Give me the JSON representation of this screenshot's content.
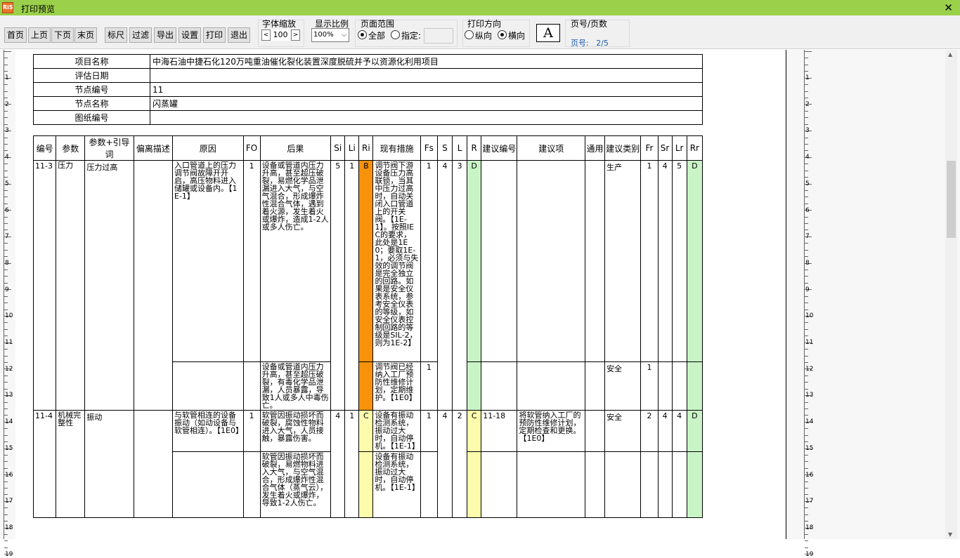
{
  "window": {
    "title": "打印预览",
    "close": "✕",
    "icon_text": "RiS"
  },
  "toolbar": {
    "buttons": [
      "首页",
      "上页",
      "下页",
      "末页",
      "标尺",
      "过滤",
      "导出",
      "设置",
      "打印",
      "退出"
    ],
    "font_scale": {
      "label": "字体缩放",
      "minus": "<",
      "value": "100",
      "plus": ">"
    },
    "display_ratio": {
      "label": "显示比例",
      "value": "100%"
    },
    "page_range": {
      "label": "页面范围",
      "all": "全部",
      "specify": "指定:",
      "selected": "all"
    },
    "orientation": {
      "label": "打印方向",
      "portrait": "纵向",
      "landscape": "横向",
      "selected": "landscape"
    },
    "font_icon": "A",
    "page_count": {
      "label": "页号/页数",
      "page_label": "页号:",
      "value": "2/5"
    }
  },
  "ruler": {
    "left": [
      "1",
      "2",
      "3",
      "4",
      "5",
      "6",
      "7",
      "8",
      "9",
      "10",
      "11",
      "12",
      "13",
      "14",
      "15",
      "16",
      "17",
      "18",
      "19"
    ],
    "right": [
      "1",
      "2",
      "3",
      "4",
      "5",
      "6",
      "7",
      "8",
      "9",
      "10",
      "11",
      "12",
      "13",
      "14",
      "15",
      "16",
      "17",
      "18",
      "19"
    ]
  },
  "info": [
    {
      "k": "项目名称",
      "v": "中海石油中捷石化120万吨重油催化裂化装置深度脱硫并予以资源化利用项目"
    },
    {
      "k": "评估日期",
      "v": ""
    },
    {
      "k": "节点编号",
      "v": "11"
    },
    {
      "k": "节点名称",
      "v": "闪蒸罐"
    },
    {
      "k": "图纸编号",
      "v": ""
    }
  ],
  "table": {
    "headers": [
      "编号",
      "参数",
      "参数+引导词",
      "偏离描述",
      "原因",
      "FO",
      "后果",
      "Si",
      "Li",
      "Ri",
      "现有措施",
      "Fs",
      "S",
      "L",
      "R",
      "建议编号",
      "建议项",
      "通用",
      "建议类别",
      "Fr",
      "Sr",
      "Lr",
      "Rr"
    ],
    "rows": [
      {
        "id": "11-3",
        "param": "压力",
        "guide": "压力过高",
        "dev": "",
        "cause": "入口管道上的压力调节阀故障开开启，高压物料进入储罐或设备内。【1E-1】",
        "fo": "1",
        "cons1": "设备或管道内压力升高，甚至超压破裂，易燃化学品泄漏进入大气，与空气混合，形成爆炸性混合气体，遇到着火源，发生着火或爆炸，造成1-2人或多人伤亡。",
        "si": "5",
        "li": "1",
        "ri": "B",
        "measure1": "调节阀下游设备压力高联锁，当其中压力过高时，自动关闭入口管道上的开关阀。【1E-1】。按照IEC的要求，此处是1E0；要取1E-1，必须与失效的调节阀是完全独立的回路。如果是安全仪表系统，参考安全仪表的等级，如安全仪表控制回路的等级是SIL-2，则为1E-2】",
        "fs": "1",
        "s": "4",
        "l": "3",
        "r": "D",
        "sug_no": "",
        "sug": "",
        "gen": "",
        "cat1": "生产",
        "fr1": "1",
        "sr": "4",
        "lr": "5",
        "rr": "D",
        "cons2": "设备或管道内压力升高，甚至超压破裂，有毒化学品泄漏，人员暴露，导致1人或多人中毒伤亡。",
        "measure2": "调节阀已经纳入工厂预防性维修计划，定期维护。【1E0】",
        "fs2": "1",
        "cat2": "安全",
        "fr2": "1"
      },
      {
        "id": "11-4",
        "param": "机械完整性",
        "guide": "振动",
        "dev": "",
        "cause": "与软管相连的设备振动（如动设备与软管相连）。【1E0】",
        "fo": "1",
        "cons1": "软管因振动损坏而破裂，腐蚀性物料进入大气，人员接触，暴露伤害。",
        "si": "4",
        "li": "1",
        "ri": "C",
        "measure1": "设备有振动检测系统，振动过大时，自动停机。【1E-1】",
        "fs": "1",
        "s": "4",
        "l": "2",
        "r": "C",
        "sug_no": "11-18",
        "sug": "将软管纳入工厂的预防性维修计划，定期检查和更换。【1E0】",
        "gen": "",
        "cat1": "安全",
        "fr1": "2",
        "sr": "4",
        "lr": "4",
        "rr": "D",
        "cons2": "软管因振动损坏而破裂，易燃物料进入大气，与空气混合，形成爆炸性混合气体（蒸气云），发生着火或爆炸，导致1-2人伤亡。",
        "measure2": "设备有振动检测系统，振动过大时，自动停机。【1E-1】"
      }
    ]
  },
  "colors": {
    "titlebar": "#9ad04a",
    "ri_b": "#f7920a",
    "ri_c": "#fdfbac",
    "risk_d": "#c9f5c6",
    "page_info": "#1d5bb5"
  }
}
